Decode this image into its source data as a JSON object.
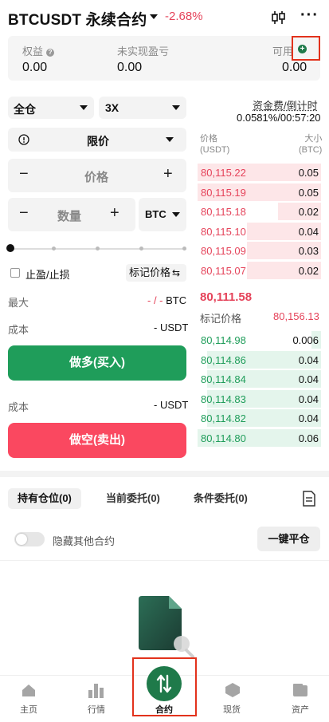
{
  "header": {
    "title": "BTCUSDT 永续合约",
    "change": "-2.68%"
  },
  "account": {
    "equity_label": "权益",
    "equity_value": "0.00",
    "unrealized_label": "未实现盈亏",
    "unrealized_value": "0.00",
    "available_label": "可用",
    "available_value": "0.00"
  },
  "controls": {
    "margin_mode": "全仓",
    "leverage": "3X",
    "order_type": "限价",
    "price_placeholder": "价格",
    "qty_placeholder": "数量",
    "unit": "BTC",
    "minus": "−",
    "plus": "+",
    "tpsl_label": "止盈/止损",
    "mark_price_btn": "标记价格",
    "max_label": "最大",
    "max_value": "- / - BTC",
    "cost_label": "成本",
    "cost_value": "- USDT",
    "long_button": "做多(买入)",
    "cost2_label": "成本",
    "cost2_value": "- USDT",
    "short_button": "做空(卖出)"
  },
  "funding": {
    "label": "资金费/倒计时",
    "value": "0.0581%/00:57:20"
  },
  "orderbook": {
    "price_header": "价格",
    "price_unit": "(USDT)",
    "size_header": "大小",
    "size_unit": "(BTC)",
    "asks": [
      {
        "price": "80,115.22",
        "size": "0.05",
        "depth": 1.0
      },
      {
        "price": "80,115.19",
        "size": "0.05",
        "depth": 1.0
      },
      {
        "price": "80,115.18",
        "size": "0.02",
        "depth": 0.35
      },
      {
        "price": "80,115.10",
        "size": "0.04",
        "depth": 0.6
      },
      {
        "price": "80,115.09",
        "size": "0.03",
        "depth": 0.6
      },
      {
        "price": "80,115.07",
        "size": "0.02",
        "depth": 0.6
      }
    ],
    "last_price": "80,111.58",
    "mark_label": "标记价格",
    "mark_value": "80,156.13",
    "bids": [
      {
        "price": "80,114.98",
        "size": "0.006",
        "depth": 0.08
      },
      {
        "price": "80,114.86",
        "size": "0.04",
        "depth": 0.92
      },
      {
        "price": "80,114.84",
        "size": "0.04",
        "depth": 0.92
      },
      {
        "price": "80,114.83",
        "size": "0.04",
        "depth": 0.92
      },
      {
        "price": "80,114.82",
        "size": "0.04",
        "depth": 0.92
      },
      {
        "price": "80,114.80",
        "size": "0.06",
        "depth": 1.0
      }
    ]
  },
  "tabs": {
    "positions": "持有仓位(0)",
    "open_orders": "当前委托(0)",
    "conditional": "条件委托(0)"
  },
  "positions": {
    "hide_other": "隐藏其他合约",
    "close_all": "一键平仓"
  },
  "nav": {
    "home": "主页",
    "markets": "行情",
    "futures": "合约",
    "spot": "现货",
    "assets": "资产"
  },
  "colors": {
    "green": "#1f9d5a",
    "red": "#e5435a",
    "highlight": "#e2321c"
  }
}
